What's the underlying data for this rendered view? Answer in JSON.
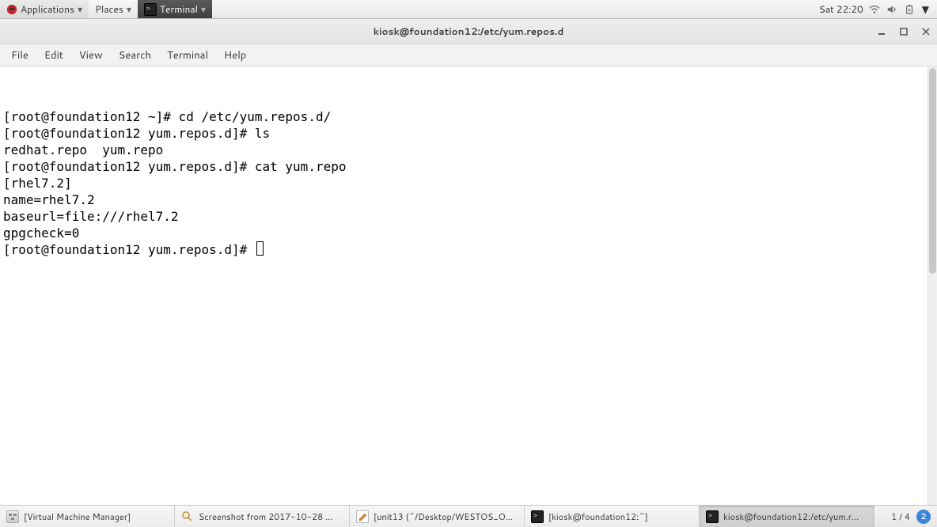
{
  "top_panel": {
    "applications": "Applications",
    "places": "Places",
    "terminal": "Terminal",
    "clock": "Sat 22:20"
  },
  "window": {
    "title": "kiosk@foundation12:/etc/yum.repos.d"
  },
  "menubar": {
    "file": "File",
    "edit": "Edit",
    "view": "View",
    "search": "Search",
    "terminal": "Terminal",
    "help": "Help"
  },
  "terminal": {
    "lines": [
      "[root@foundation12 ~]# cd /etc/yum.repos.d/",
      "[root@foundation12 yum.repos.d]# ls",
      "redhat.repo  yum.repo",
      "[root@foundation12 yum.repos.d]# cat yum.repo",
      "[rhel7.2]",
      "name=rhel7.2",
      "baseurl=file:///rhel7.2",
      "gpgcheck=0"
    ],
    "prompt": "[root@foundation12 yum.repos.d]# "
  },
  "taskbar": {
    "items": [
      {
        "label": "[Virtual Machine Manager]"
      },
      {
        "label": "Screenshot from 2017-10-28 ..."
      },
      {
        "label": "[unit13 (~/Desktop/WESTOS_O..."
      },
      {
        "label": "[kiosk@foundation12:~]"
      },
      {
        "label": "kiosk@foundation12:/etc/yum.r..."
      }
    ],
    "workspace": "1 / 4",
    "notif": "2"
  }
}
